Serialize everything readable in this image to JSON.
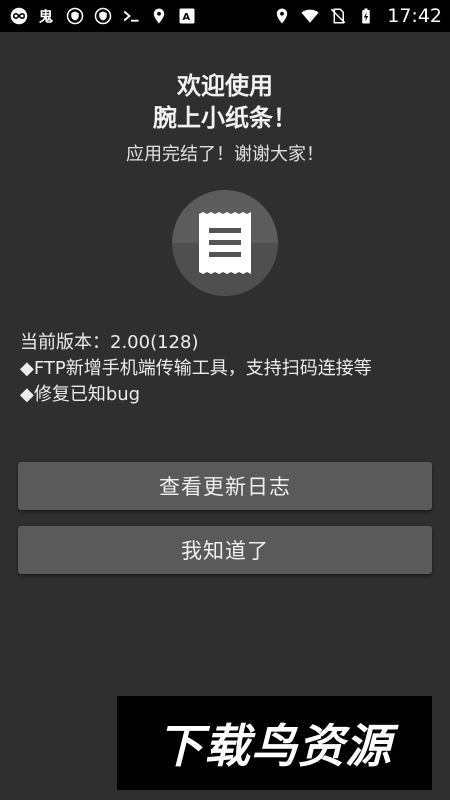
{
  "status_bar": {
    "time": "17:42",
    "left_icons": [
      "infinity-icon",
      "ghost-icon",
      "vpn-shield-icon",
      "vpn-shield-icon",
      "terminal-icon",
      "location-icon",
      "font-icon"
    ],
    "right_icons": [
      "location-icon",
      "wifi-icon",
      "no-sim-icon",
      "battery-charging-icon"
    ]
  },
  "header": {
    "title_line1": "欢迎使用",
    "title_line2": "腕上小纸条！",
    "subtitle": "应用完结了！谢谢大家！"
  },
  "app_icon": "receipt-icon",
  "info": {
    "version": "当前版本：2.00(128)",
    "change1": "◆FTP新增手机端传输工具，支持扫码连接等",
    "change2": "◆修复已知bug"
  },
  "buttons": {
    "changelog": "查看更新日志",
    "ok": "我知道了"
  },
  "watermark": {
    "text": "下载鸟资源"
  },
  "colors": {
    "background": "#2f2f2f",
    "button": "#5a5a5a",
    "statusbar": "#000000"
  }
}
